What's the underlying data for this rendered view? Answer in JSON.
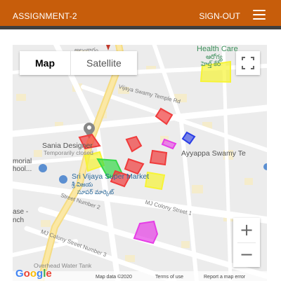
{
  "header": {
    "title": "ASSIGNMENT-2",
    "signout_label": "SIGN-OUT",
    "menu_icon": "hamburger-menu-icon",
    "bg_color": "#c75d0b",
    "bar_color": "#3f3f3f"
  },
  "map": {
    "map_type_buttons": {
      "map": "Map",
      "satellite": "Satellite",
      "selected": "Map"
    },
    "fullscreen_icon": "fullscreen-icon",
    "zoom": {
      "in": "+",
      "out": "−"
    },
    "labels": {
      "health_care": "Health Care",
      "health_care_telugu": "ఆరోగ్య",
      "hc_sub": "హెల్త్ కేర్",
      "top_telugu": "అలంకారం",
      "vijaya_swamy": "Vijaya Swamy Temple Rd",
      "sania": "Sania Designer",
      "temp_closed": "Temporarily closed",
      "ayyappa": "Ayyappa Swamy Te",
      "memorial": "morial",
      "school": "hool...",
      "sri_vijaya": "Sri Vijaya Super Market",
      "sri_vijaya_te": "శ్రీ విజయ",
      "super_te": "సూపర్ మార్కెట్",
      "street2": "Street Number 2",
      "mj_colony_1": "MJ Colony Street 1",
      "mj_colony_3": "MJ Colony Street Number 3",
      "tank": "Overhead Water Tank",
      "ranch": "nch",
      "ase": "ase -"
    },
    "footer": {
      "google": "Google",
      "map_data": "Map data ©2020",
      "terms": "Terms of use",
      "report": "Report a map error"
    },
    "polygon_colors": {
      "red": "#f03c3c",
      "yellow": "#f7f436",
      "green": "#37d94a",
      "blue": "#2a3ee6",
      "magenta": "#e63ee6"
    }
  }
}
